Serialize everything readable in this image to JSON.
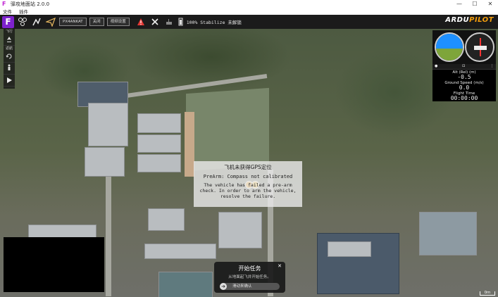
{
  "window": {
    "title": "驿攻地面站 2.0.0",
    "min": "—",
    "max": "☐",
    "close": "✕"
  },
  "menu": {
    "items": [
      "文件",
      "插件"
    ]
  },
  "toolbar": {
    "buttons": [
      "PX4ANKAT",
      "关闭",
      "视频设置"
    ],
    "status": "100% Stabilize 未解锁",
    "brand_a": "ARDU",
    "brand_b": "PILOT"
  },
  "left_panel": {
    "label_top": "飞行",
    "label_mid": "返航"
  },
  "instrument": {
    "heading_value": ""
  },
  "telemetry": {
    "header_left": "●",
    "header_mid": "⊡",
    "header_right": "⋮",
    "alt_label": "Alt (Rel) (m)",
    "alt_value": "-0.5",
    "gs_label": "Ground Speed (m/s)",
    "gs_value": "0.0",
    "ft_label": "Flight Time",
    "ft_value": "00:00:00"
  },
  "message": {
    "title": "飞机未获得GPS定位",
    "line1": "PreArm: Compass not calibrated",
    "line2": "The vehicle has failed a pre-arm check. In order to arm the vehicle, resolve the failure."
  },
  "mission": {
    "title": "开始任务",
    "subtitle": "从地面起飞并开始任务。",
    "slider_label": "滑动来确认",
    "close": "✕"
  },
  "map": {
    "scale_text": "0m"
  }
}
